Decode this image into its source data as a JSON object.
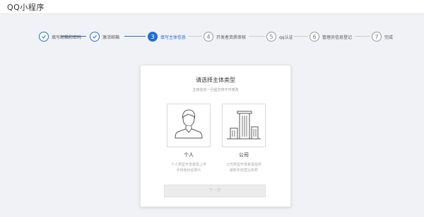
{
  "app_title": "QQ小程序",
  "steps": [
    {
      "number": "1",
      "label": "填写邮箱和密码",
      "status": "done"
    },
    {
      "number": "2",
      "label": "激活邮箱",
      "status": "done"
    },
    {
      "number": "3",
      "label": "填写主体信息",
      "status": "active"
    },
    {
      "number": "4",
      "label": "开发者资质审核",
      "status": "pending"
    },
    {
      "number": "5",
      "label": "qq认证",
      "status": "pending"
    },
    {
      "number": "6",
      "label": "管理员信息登记",
      "status": "pending"
    },
    {
      "number": "7",
      "label": "完成",
      "status": "pending"
    }
  ],
  "card": {
    "title": "请选择主体类型",
    "subtitle": "主体信息一旦提交将不可修改",
    "options": [
      {
        "name": "个人",
        "icon": "person-icon",
        "desc_line1": "个人类型开发者需上传",
        "desc_line2": "手持身份证照片"
      },
      {
        "name": "公司",
        "icon": "building-icon",
        "desc_line1": "公司类型开发者需提供",
        "desc_line2": "最新年检营业执照"
      }
    ],
    "next_label": "下一步"
  },
  "colors": {
    "accent": "#1f6fd6",
    "background": "#f0f2f5"
  }
}
